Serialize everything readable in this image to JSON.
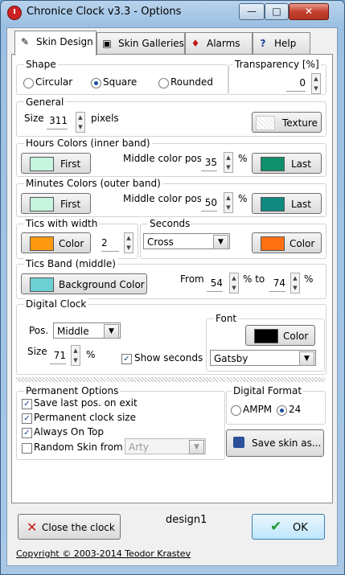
{
  "window": {
    "title": "Chronice Clock v3.3  -  Options",
    "min": "—",
    "max": "□",
    "close": "✕"
  },
  "tabs": [
    {
      "label": "Skin Design",
      "icon": "✎"
    },
    {
      "label": "Skin Galleries",
      "icon": "▣"
    },
    {
      "label": "Alarms",
      "icon": "♦"
    },
    {
      "label": "Help",
      "icon": "?"
    }
  ],
  "shape": {
    "label": "Shape",
    "options": [
      "Circular",
      "Square",
      "Rounded"
    ],
    "selected": "Square"
  },
  "transparency": {
    "label": "Transparency [%]",
    "value": "0"
  },
  "general": {
    "label": "General",
    "size_label": "Size",
    "size_value": "311",
    "size_unit": "pixels",
    "texture_label": "Texture"
  },
  "hours_colors": {
    "label": "Hours Colors (inner band)",
    "first_label": "First",
    "first_color": "#c8f5e0",
    "middle_label": "Middle color pos.",
    "middle_value": "35",
    "unit": "%",
    "last_label": "Last",
    "last_color": "#10906a"
  },
  "minutes_colors": {
    "label": "Minutes Colors (outer band)",
    "first_label": "First",
    "first_color": "#c8f5e0",
    "middle_label": "Middle color pos.",
    "middle_value": "50",
    "unit": "%",
    "last_label": "Last",
    "last_color": "#108a80"
  },
  "tics": {
    "label": "Tics with width",
    "color_label": "Color",
    "color": "#ff9a10",
    "width_value": "2"
  },
  "seconds": {
    "label": "Seconds",
    "style": "Cross",
    "color_label": "Color",
    "color": "#ff7010"
  },
  "tics_band": {
    "label": "Tics Band (middle)",
    "bg_label": "Background Color",
    "bg_color": "#6ccfd2",
    "from_label": "From",
    "from_value": "54",
    "pct_to": "%  to",
    "to_value": "74",
    "unit": "%"
  },
  "digital_clock": {
    "label": "Digital Clock",
    "pos_label": "Pos.",
    "pos_value": "Middle",
    "size_label": "Size",
    "size_value": "71",
    "unit": "%",
    "show_seconds_label": "Show seconds",
    "show_seconds": true
  },
  "font": {
    "label": "Font",
    "color_label": "Color",
    "color": "#000000",
    "family": "Gatsby"
  },
  "permanent": {
    "label": "Permanent Options",
    "items": [
      {
        "label": "Save last pos. on exit",
        "checked": true
      },
      {
        "label": "Permanent clock size",
        "checked": true
      },
      {
        "label": "Always On Top",
        "checked": true
      },
      {
        "label": "Random Skin from",
        "checked": false
      }
    ],
    "random_value": "Arty"
  },
  "digital_format": {
    "label": "Digital Format",
    "options": [
      "AMPM",
      "24"
    ],
    "selected": "24"
  },
  "save_skin_label": "Save skin as...",
  "footer": {
    "close_label": "Close the clock",
    "design_name": "design1",
    "ok_label": "OK",
    "copyright": "Copyright © 2003-2014  Teodor Krastev"
  }
}
